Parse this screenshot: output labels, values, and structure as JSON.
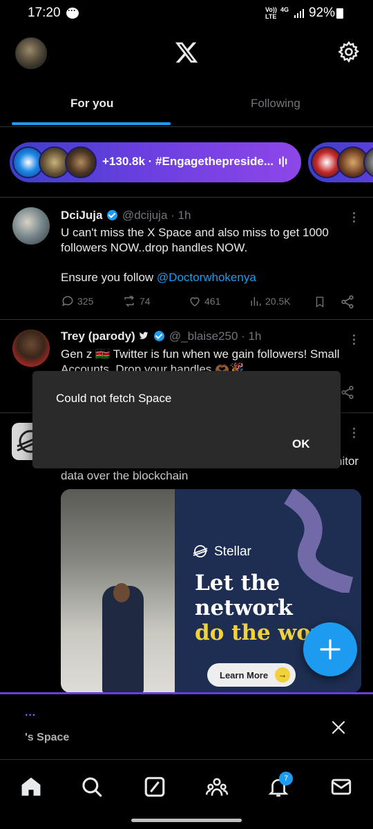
{
  "status_bar": {
    "time": "17:20",
    "network_top": "Vo))",
    "network_bottom": "LTE",
    "net_type": "4G",
    "battery": "92%"
  },
  "tabs": {
    "for_you": "For you",
    "following": "Following"
  },
  "spaces": {
    "listeners_topic": "+130.8k · #Engagethepreside..."
  },
  "tweets": [
    {
      "name": "DciJuja",
      "handle": "@dcijuja · 1h",
      "text": "U can't miss the X Space  and also miss to get 1000 followers NOW..drop handles NOW.",
      "text2_prefix": "Ensure you follow ",
      "link": "@Doctorwhokenya",
      "replies": "325",
      "retweets": "74",
      "likes": "461",
      "views": "20.5K"
    },
    {
      "name": "Trey (parody)",
      "handle": "@_blaise250 · 1h",
      "text": "Gen z 🇰🇪 Twitter is fun when we gain followers! Small Accounts, Drop your handles 🫶🏾🎉"
    },
    {
      "text_tail": "nitor",
      "text_line2": "data over the blockchain"
    }
  ],
  "dialog": {
    "message": "Could not fetch Space",
    "ok": "OK"
  },
  "ad": {
    "brand": "Stellar",
    "headline_1": "Let the",
    "headline_2": "network",
    "headline_3": "do the wor",
    "cta": "Learn More"
  },
  "space_bar": {
    "dots": "···",
    "label": "'s Space"
  },
  "nav": {
    "notification_count": "7"
  },
  "colors": {
    "accent": "#1d9bf0",
    "background": "#000000",
    "space_purple": "#6a3fe0",
    "muted": "#71767b"
  }
}
